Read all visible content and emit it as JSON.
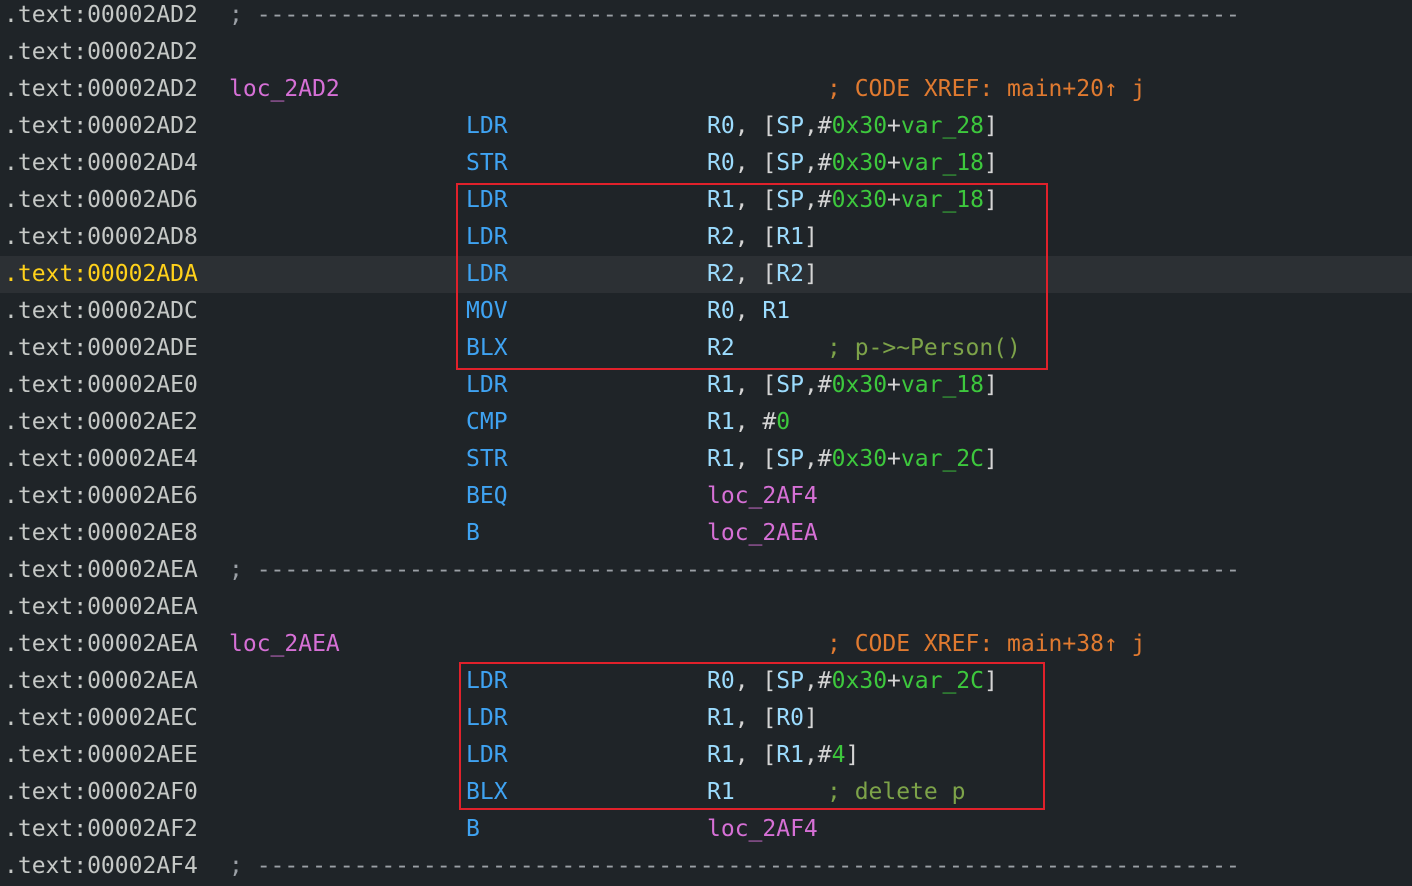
{
  "listing": {
    "rows": [
      {
        "addr": ".text:00002AD2",
        "sep": "; -----------------------------------------------------------------------"
      },
      {
        "addr": ".text:00002AD2"
      },
      {
        "addr": ".text:00002AD2",
        "label": "loc_2AD2",
        "xref": "; CODE XREF: main+20↑ j"
      },
      {
        "addr": ".text:00002AD2",
        "mnemonic": "LDR",
        "operands": [
          [
            "R0",
            "rg"
          ],
          [
            ", [",
            "pn"
          ],
          [
            "SP",
            "rg"
          ],
          [
            ",#",
            "pn"
          ],
          [
            "0x30",
            "nm"
          ],
          [
            "+",
            "pn"
          ],
          [
            "var_28",
            "vr"
          ],
          [
            "]",
            "pn"
          ]
        ]
      },
      {
        "addr": ".text:00002AD4",
        "mnemonic": "STR",
        "operands": [
          [
            "R0",
            "rg"
          ],
          [
            ", [",
            "pn"
          ],
          [
            "SP",
            "rg"
          ],
          [
            ",#",
            "pn"
          ],
          [
            "0x30",
            "nm"
          ],
          [
            "+",
            "pn"
          ],
          [
            "var_18",
            "vr"
          ],
          [
            "]",
            "pn"
          ]
        ]
      },
      {
        "addr": ".text:00002AD6",
        "mnemonic": "LDR",
        "operands": [
          [
            "R1",
            "rg"
          ],
          [
            ", [",
            "pn"
          ],
          [
            "SP",
            "rg"
          ],
          [
            ",#",
            "pn"
          ],
          [
            "0x30",
            "nm"
          ],
          [
            "+",
            "pn"
          ],
          [
            "var_18",
            "vr"
          ],
          [
            "]",
            "pn"
          ]
        ]
      },
      {
        "addr": ".text:00002AD8",
        "mnemonic": "LDR",
        "operands": [
          [
            "R2",
            "rg"
          ],
          [
            ", [",
            "pn"
          ],
          [
            "R1",
            "rg"
          ],
          [
            "]",
            "pn"
          ]
        ]
      },
      {
        "addr": ".text:00002ADA",
        "current": true,
        "mnemonic": "LDR",
        "operands": [
          [
            "R2",
            "rg"
          ],
          [
            ", [",
            "pn"
          ],
          [
            "R2",
            "rg"
          ],
          [
            "]",
            "pn"
          ]
        ]
      },
      {
        "addr": ".text:00002ADC",
        "mnemonic": "MOV",
        "operands": [
          [
            "R0",
            "rg"
          ],
          [
            ", ",
            "pn"
          ],
          [
            "R1",
            "rg"
          ]
        ]
      },
      {
        "addr": ".text:00002ADE",
        "mnemonic": "BLX",
        "operands": [
          [
            "R2",
            "rg"
          ]
        ],
        "comment": "; p->~Person()"
      },
      {
        "addr": ".text:00002AE0",
        "mnemonic": "LDR",
        "operands": [
          [
            "R1",
            "rg"
          ],
          [
            ", [",
            "pn"
          ],
          [
            "SP",
            "rg"
          ],
          [
            ",#",
            "pn"
          ],
          [
            "0x30",
            "nm"
          ],
          [
            "+",
            "pn"
          ],
          [
            "var_18",
            "vr"
          ],
          [
            "]",
            "pn"
          ]
        ]
      },
      {
        "addr": ".text:00002AE2",
        "mnemonic": "CMP",
        "operands": [
          [
            "R1",
            "rg"
          ],
          [
            ", #",
            "pn"
          ],
          [
            "0",
            "nm"
          ]
        ]
      },
      {
        "addr": ".text:00002AE4",
        "mnemonic": "STR",
        "operands": [
          [
            "R1",
            "rg"
          ],
          [
            ", [",
            "pn"
          ],
          [
            "SP",
            "rg"
          ],
          [
            ",#",
            "pn"
          ],
          [
            "0x30",
            "nm"
          ],
          [
            "+",
            "pn"
          ],
          [
            "var_2C",
            "vr"
          ],
          [
            "]",
            "pn"
          ]
        ]
      },
      {
        "addr": ".text:00002AE6",
        "mnemonic": "BEQ",
        "operands": [
          [
            "loc_2AF4",
            "tg"
          ]
        ]
      },
      {
        "addr": ".text:00002AE8",
        "mnemonic": "B",
        "operands": [
          [
            "loc_2AEA",
            "tg"
          ]
        ]
      },
      {
        "addr": ".text:00002AEA",
        "sep": "; -----------------------------------------------------------------------"
      },
      {
        "addr": ".text:00002AEA"
      },
      {
        "addr": ".text:00002AEA",
        "label": "loc_2AEA",
        "xref": "; CODE XREF: main+38↑ j"
      },
      {
        "addr": ".text:00002AEA",
        "mnemonic": "LDR",
        "operands": [
          [
            "R0",
            "rg"
          ],
          [
            ", [",
            "pn"
          ],
          [
            "SP",
            "rg"
          ],
          [
            ",#",
            "pn"
          ],
          [
            "0x30",
            "nm"
          ],
          [
            "+",
            "pn"
          ],
          [
            "var_2C",
            "vr"
          ],
          [
            "]",
            "pn"
          ]
        ]
      },
      {
        "addr": ".text:00002AEC",
        "mnemonic": "LDR",
        "operands": [
          [
            "R1",
            "rg"
          ],
          [
            ", [",
            "pn"
          ],
          [
            "R0",
            "rg"
          ],
          [
            "]",
            "pn"
          ]
        ]
      },
      {
        "addr": ".text:00002AEE",
        "mnemonic": "LDR",
        "operands": [
          [
            "R1",
            "rg"
          ],
          [
            ", [",
            "pn"
          ],
          [
            "R1",
            "rg"
          ],
          [
            ",#",
            "pn"
          ],
          [
            "4",
            "nm"
          ],
          [
            "]",
            "pn"
          ]
        ]
      },
      {
        "addr": ".text:00002AF0",
        "mnemonic": "BLX",
        "operands": [
          [
            "R1",
            "rg"
          ]
        ],
        "comment": "; delete p"
      },
      {
        "addr": ".text:00002AF2",
        "mnemonic": "B",
        "operands": [
          [
            "loc_2AF4",
            "tg"
          ]
        ]
      },
      {
        "addr": ".text:00002AF4",
        "sep": "; -----------------------------------------------------------------------"
      }
    ]
  },
  "colors": {
    "background": "#1f2428",
    "current_line": "#2c3034",
    "current_address": "#ffd11a",
    "mnemonic": "#3fa3f2",
    "label": "#d670d6",
    "xref": "#e07a30",
    "comment": "#7da349",
    "highlight_box": "#e0212b"
  }
}
